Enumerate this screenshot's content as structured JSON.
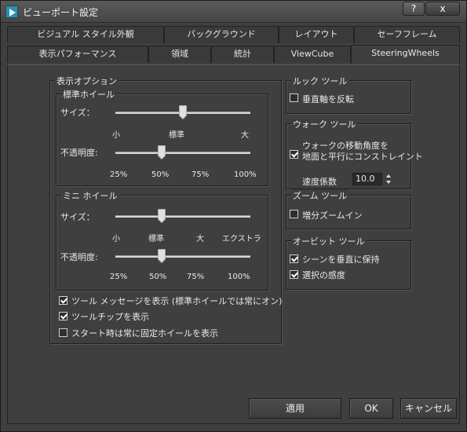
{
  "window": {
    "title": "ビューポート設定"
  },
  "titlebar": {
    "help": "?",
    "close": "x"
  },
  "tabs_row1": [
    "ビジュアル スタイル外観",
    "バックグラウンド",
    "レイアウト",
    "セーフフレーム"
  ],
  "tabs_row2": [
    "表示パフォーマンス",
    "領域",
    "統計",
    "ViewCube",
    "SteeringWheels"
  ],
  "display_options": {
    "title": "表示オプション",
    "standard_wheel": {
      "title": "標準ホイール",
      "size_label": "サイズ：",
      "size_ticks": [
        "小",
        "標準",
        "大"
      ],
      "size_value": 0.5,
      "opacity_label": "不透明度:",
      "opacity_ticks": [
        "25%",
        "50%",
        "75%",
        "100%"
      ],
      "opacity_value": 0.35
    },
    "mini_wheel": {
      "title": "ミニ ホイール",
      "size_label": "サイズ：",
      "size_ticks": [
        "小",
        "標準",
        "大",
        "エクストラ"
      ],
      "size_value": 0.35,
      "opacity_label": "不透明度:",
      "opacity_ticks": [
        "25%",
        "50%",
        "75%",
        "100%"
      ],
      "opacity_value": 0.35
    },
    "checkboxes": [
      {
        "label": "ツール メッセージを表示 (標準ホイールでは常にオン)",
        "checked": true
      },
      {
        "label": "ツールチップを表示",
        "checked": true
      },
      {
        "label": "スタート時は常に固定ホイールを表示",
        "checked": false
      }
    ]
  },
  "look_tool": {
    "title": "ルック ツール",
    "invert_label": "垂直軸を反転",
    "invert_checked": false
  },
  "walk_tool": {
    "title": "ウォーク ツール",
    "constrain_label_1": "ウォークの移動角度を",
    "constrain_label_2": "地面と平行にコンストレイント",
    "constrain_checked": true,
    "speed_label": "速度係数",
    "speed_value": "10.0"
  },
  "zoom_tool": {
    "title": "ズーム ツール",
    "incremental_label": "増分ズームイン",
    "incremental_checked": false
  },
  "orbit_tool": {
    "title": "オービット ツール",
    "keep_upright_label": "シーンを垂直に保持",
    "keep_upright_checked": true,
    "selection_sensitivity_label": "選択の感度",
    "selection_sensitivity_checked": true
  },
  "buttons": {
    "apply": "適用",
    "ok": "OK",
    "cancel": "キャンセル"
  }
}
